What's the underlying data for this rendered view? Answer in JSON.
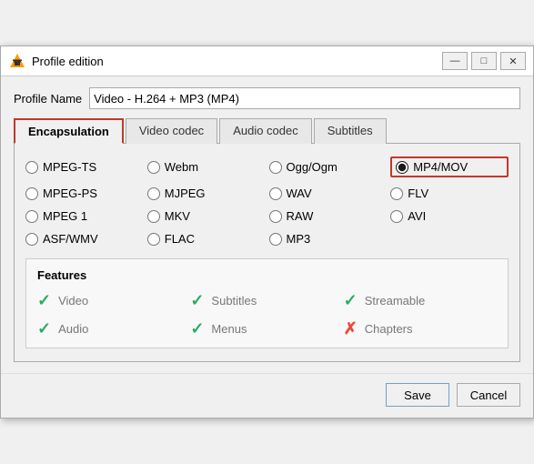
{
  "window": {
    "title": "Profile edition",
    "icon": "vlc-icon"
  },
  "title_controls": {
    "minimize": "—",
    "maximize": "□",
    "close": "✕"
  },
  "profile_name": {
    "label": "Profile Name",
    "value": "Video - H.264 + MP3 (MP4)"
  },
  "tabs": [
    {
      "id": "encapsulation",
      "label": "Encapsulation",
      "active": true
    },
    {
      "id": "video-codec",
      "label": "Video codec",
      "active": false
    },
    {
      "id": "audio-codec",
      "label": "Audio codec",
      "active": false
    },
    {
      "id": "subtitles",
      "label": "Subtitles",
      "active": false
    }
  ],
  "encapsulation": {
    "options": [
      {
        "id": "mpeg-ts",
        "label": "MPEG-TS",
        "selected": false,
        "col": 1
      },
      {
        "id": "webm",
        "label": "Webm",
        "selected": false,
        "col": 2
      },
      {
        "id": "ogg-ogm",
        "label": "Ogg/Ogm",
        "selected": false,
        "col": 3
      },
      {
        "id": "mp4-mov",
        "label": "MP4/MOV",
        "selected": true,
        "col": 4
      },
      {
        "id": "mpeg-ps",
        "label": "MPEG-PS",
        "selected": false,
        "col": 1
      },
      {
        "id": "mjpeg",
        "label": "MJPEG",
        "selected": false,
        "col": 2
      },
      {
        "id": "wav",
        "label": "WAV",
        "selected": false,
        "col": 3
      },
      {
        "id": "flv",
        "label": "FLV",
        "selected": false,
        "col": 4
      },
      {
        "id": "mpeg1",
        "label": "MPEG 1",
        "selected": false,
        "col": 1
      },
      {
        "id": "mkv",
        "label": "MKV",
        "selected": false,
        "col": 2
      },
      {
        "id": "raw",
        "label": "RAW",
        "selected": false,
        "col": 3
      },
      {
        "id": "avi",
        "label": "AVI",
        "selected": false,
        "col": 4
      },
      {
        "id": "asf-wmv",
        "label": "ASF/WMV",
        "selected": false,
        "col": 1
      },
      {
        "id": "flac",
        "label": "FLAC",
        "selected": false,
        "col": 2
      },
      {
        "id": "mp3",
        "label": "MP3",
        "selected": false,
        "col": 3
      }
    ],
    "features": {
      "title": "Features",
      "items": [
        {
          "id": "video",
          "label": "Video",
          "enabled": true
        },
        {
          "id": "subtitles",
          "label": "Subtitles",
          "enabled": true
        },
        {
          "id": "streamable",
          "label": "Streamable",
          "enabled": true
        },
        {
          "id": "audio",
          "label": "Audio",
          "enabled": true
        },
        {
          "id": "menus",
          "label": "Menus",
          "enabled": true
        },
        {
          "id": "chapters",
          "label": "Chapters",
          "enabled": false
        }
      ]
    }
  },
  "footer": {
    "save_label": "Save",
    "cancel_label": "Cancel"
  }
}
